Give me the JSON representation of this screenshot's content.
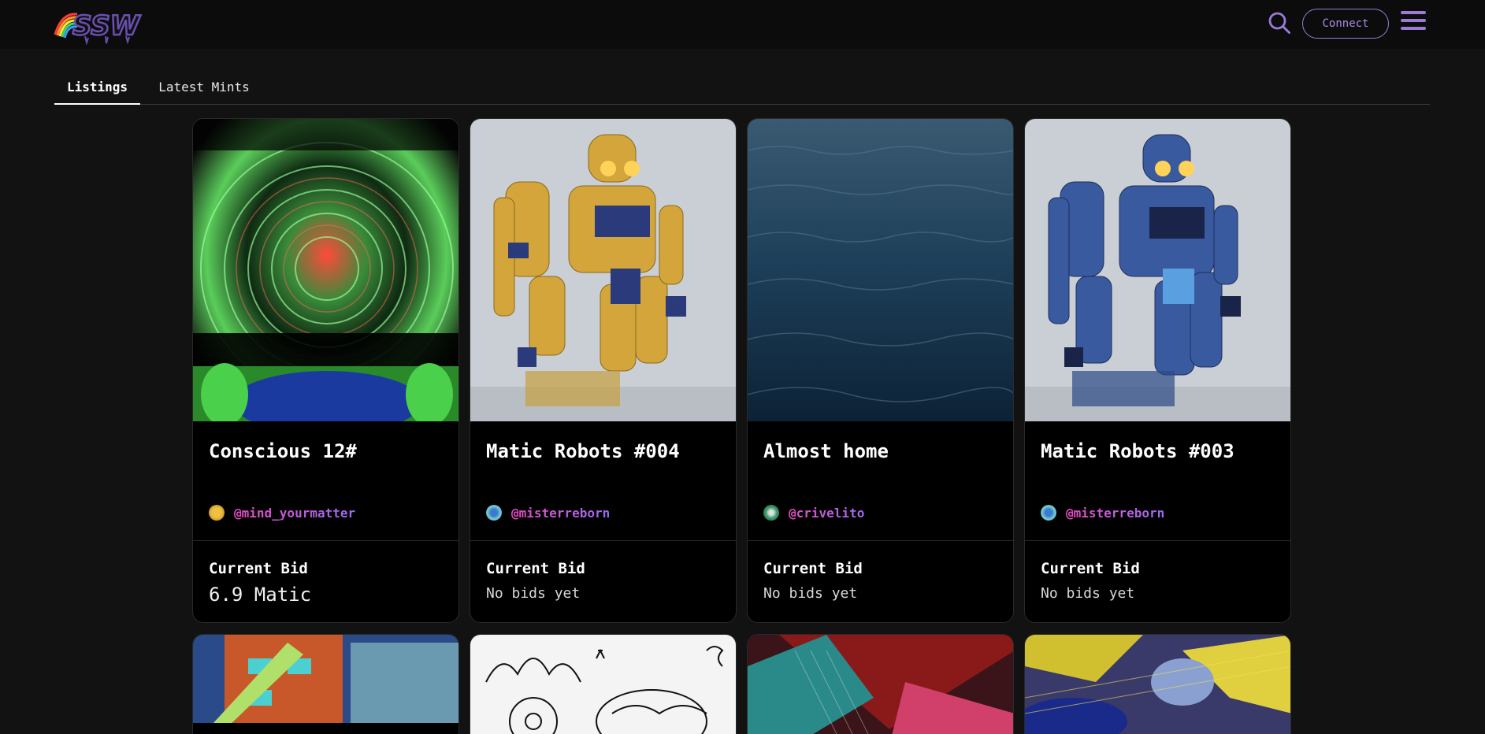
{
  "header": {
    "logo_text": "SSW",
    "connect_label": "Connect"
  },
  "tabs": [
    {
      "label": "Listings"
    },
    {
      "label": "Latest Mints"
    }
  ],
  "cards": [
    {
      "title": "Conscious 12#",
      "creator": "@mind_yourmatter",
      "bid_label": "Current Bid",
      "bid_value": "6.9 Matic"
    },
    {
      "title": "Matic Robots #004",
      "creator": "@misterreborn",
      "bid_label": "Current Bid",
      "bid_value": "No bids yet"
    },
    {
      "title": "Almost home",
      "creator": "@crivelito",
      "bid_label": "Current Bid",
      "bid_value": "No bids yet"
    },
    {
      "title": "Matic Robots #003",
      "creator": "@misterreborn",
      "bid_label": "Current Bid",
      "bid_value": "No bids yet"
    }
  ],
  "colors": {
    "accent": "#9b7bd6",
    "handle_gradient_start": "#e94bc3",
    "handle_gradient_end": "#9b6bf0",
    "background": "#121212",
    "card": "#000000"
  },
  "icons": {
    "search": "search-icon",
    "menu": "hamburger-menu-icon"
  }
}
